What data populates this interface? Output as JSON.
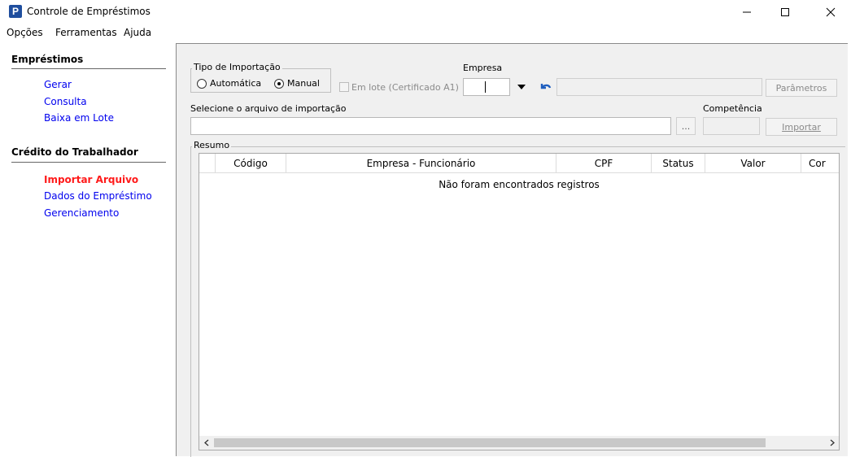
{
  "window": {
    "title": "Controle de Empréstimos",
    "app_icon_letter": "P",
    "minimize_glyph": "—",
    "maximize_glyph": "☐",
    "close_glyph": "✕"
  },
  "menu": [
    "Opções",
    "Ferramentas",
    "Ajuda"
  ],
  "sidebar": {
    "sections": [
      {
        "title": "Empréstimos",
        "items": [
          {
            "label": "Gerar",
            "active": false
          },
          {
            "label": "Consulta",
            "active": false
          },
          {
            "label": "Baixa em Lote",
            "active": false
          }
        ]
      },
      {
        "title": "Crédito do Trabalhador",
        "items": [
          {
            "label": "Importar Arquivo",
            "active": true
          },
          {
            "label": "Dados do Empréstimo",
            "active": false
          },
          {
            "label": "Gerenciamento",
            "active": false
          }
        ]
      }
    ],
    "link_color": "#0000ee",
    "active_color": "#ff1a1a"
  },
  "form": {
    "tipo_importacao": {
      "legend": "Tipo de Importação",
      "option_auto": "Automática",
      "option_manual": "Manual",
      "selected": "Manual"
    },
    "em_lote_label": "Em lote (Certificado A1)",
    "em_lote_checked": false,
    "empresa_label": "Empresa",
    "empresa_code": "",
    "empresa_name": "",
    "parametros_button": "Parâmetros",
    "arquivo_label": "Selecione o arquivo de importação",
    "arquivo_value": "",
    "browse_button": "...",
    "competencia_label": "Competência",
    "competencia_value": "",
    "importar_button": "Importar"
  },
  "resumo": {
    "legend": "Resumo",
    "columns": [
      "Código",
      "Empresa - Funcionário",
      "CPF",
      "Status",
      "Valor",
      "Cor"
    ],
    "rows": [],
    "empty_message": "Não foram encontrados registros"
  }
}
